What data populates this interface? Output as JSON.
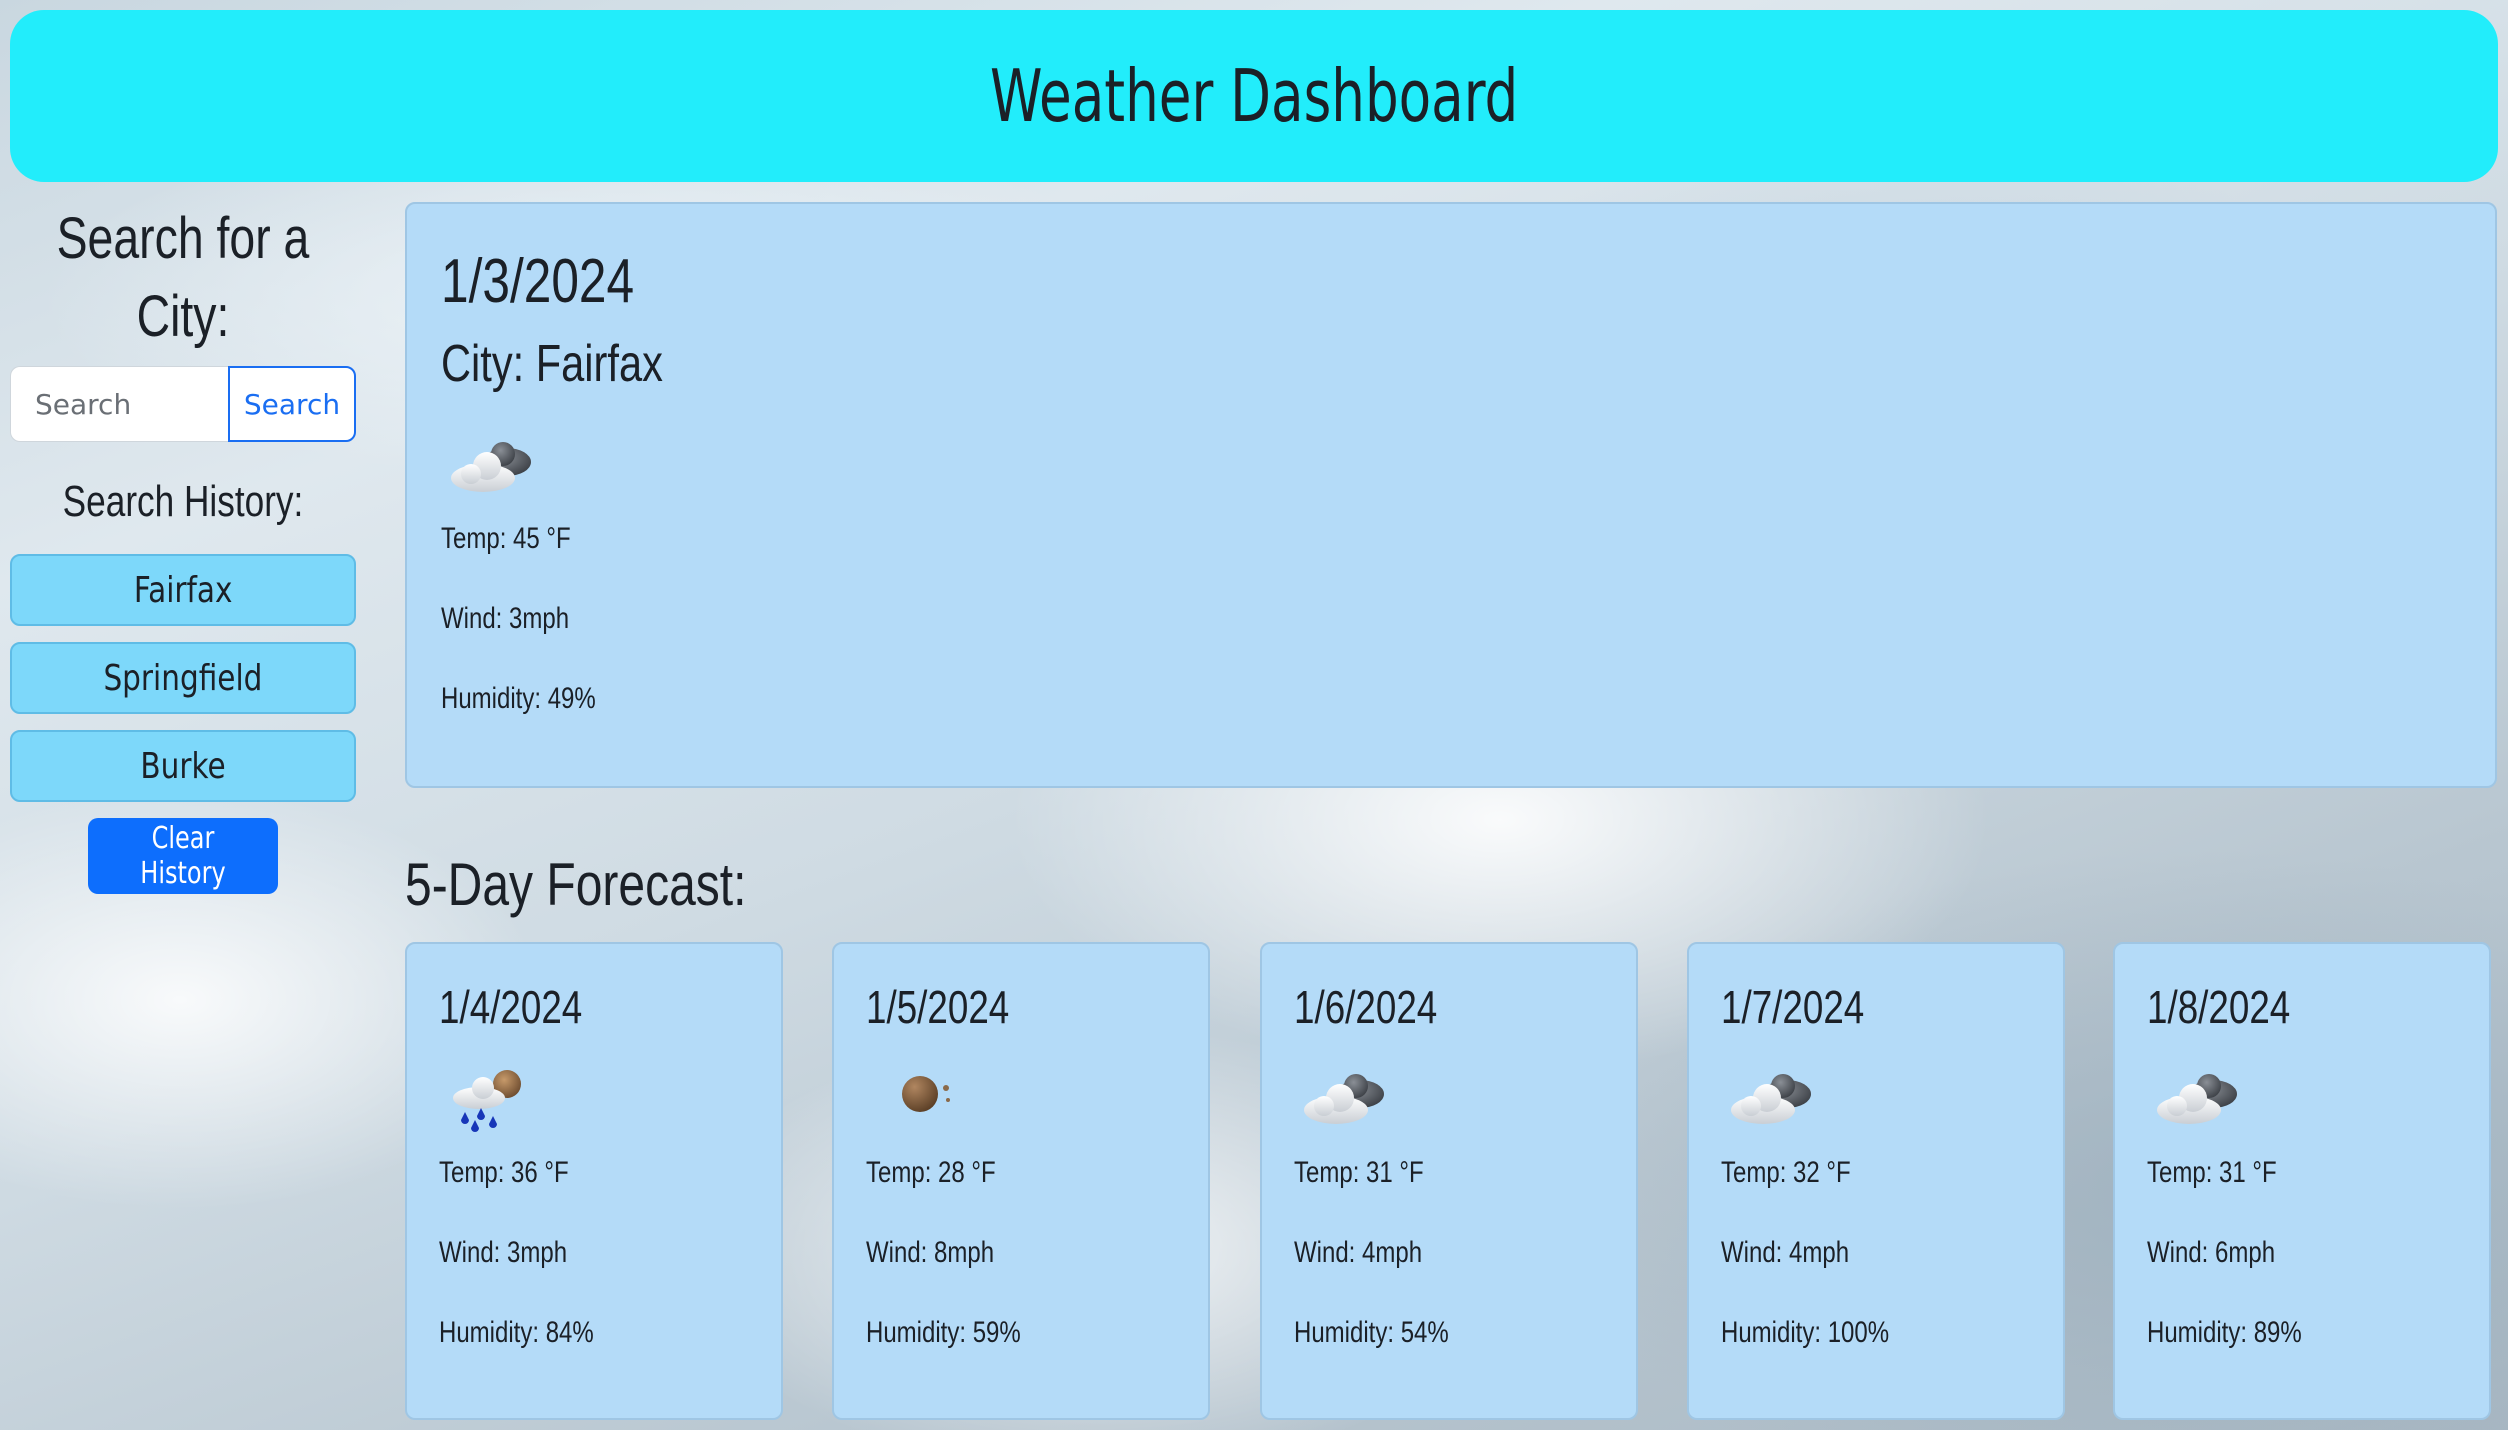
{
  "header": {
    "title": "Weather Dashboard"
  },
  "sidebar": {
    "search_title": "Search for a City:",
    "search_placeholder": "Search",
    "search_button": "Search",
    "history_title": "Search History:",
    "history": [
      {
        "label": "Fairfax"
      },
      {
        "label": "Springfield"
      },
      {
        "label": "Burke"
      }
    ],
    "clear_button": "Clear History"
  },
  "current": {
    "date": "1/3/2024",
    "city": "City: Fairfax",
    "icon": "cloudy-icon",
    "temp": "Temp: 45 °F",
    "wind": "Wind: 3mph",
    "humidity": "Humidity: 49%"
  },
  "forecast_title": "5-Day Forecast:",
  "forecast": [
    {
      "date": "1/4/2024",
      "icon": "rain-icon",
      "temp": "Temp: 36 °F",
      "wind": "Wind: 3mph",
      "humidity": "Humidity: 84%"
    },
    {
      "date": "1/5/2024",
      "icon": "moon-icon",
      "temp": "Temp: 28 °F",
      "wind": "Wind: 8mph",
      "humidity": "Humidity: 59%"
    },
    {
      "date": "1/6/2024",
      "icon": "cloudy-icon",
      "temp": "Temp: 31 °F",
      "wind": "Wind: 4mph",
      "humidity": "Humidity: 54%"
    },
    {
      "date": "1/7/2024",
      "icon": "cloudy-icon",
      "temp": "Temp: 32 °F",
      "wind": "Wind: 4mph",
      "humidity": "Humidity: 100%"
    },
    {
      "date": "1/8/2024",
      "icon": "cloudy-icon",
      "temp": "Temp: 31 °F",
      "wind": "Wind: 6mph",
      "humidity": "Humidity: 89%"
    }
  ],
  "colors": {
    "header": "#22edfb",
    "card": "#b4dbf8",
    "history_button": "#7dd8fa",
    "primary": "#0d6efd"
  }
}
